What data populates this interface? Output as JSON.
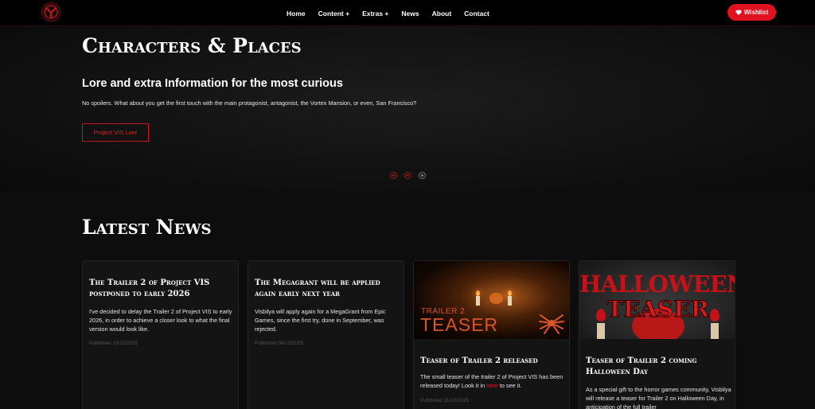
{
  "nav": {
    "logo_icon": "vortex-logo-icon",
    "links": [
      "Home",
      "Content +",
      "Extras +",
      "News",
      "About",
      "Contact"
    ],
    "wishlist_label": "Wishlist",
    "wishlist_icon": "heart-icon",
    "accent_color": "#e0121f"
  },
  "hero": {
    "title": "Characters & Places",
    "subtitle": "Lore and extra Information for the most curious",
    "text": "No spoilers. What about you get the first touch with the main protagonist, antagonist, the Vortex Mansion, or even, San Francisco?",
    "button_label": "Project VIS Lore",
    "slide_count": 3,
    "active_slide": 3
  },
  "news": {
    "title": "Latest News",
    "cards": [
      {
        "title": "The Trailer 2 of Project VIS postponed to early 2026",
        "text": "I've decided to delay the Trailer 2 of Project VIS to early 2026, in order to achieve a closer look to what the final version would look like.",
        "date": "Published 13/12/2025"
      },
      {
        "title": "The Megagrant will be applied again early next year",
        "text": "Visbilya will apply again for a MegaGrant from Epic Games, since the first try, done in September, was rejected.",
        "date": "Published 06/12/2025"
      },
      {
        "title": "Teaser of Trailer 2 released",
        "text_before": "The small teaser of the trailer 2 of Project VIS has been released today! Look it in",
        "link_text": "here",
        "text_after": "to see it.",
        "date": "Published 31/10/2025",
        "image": {
          "small_text": "TRAILER 2",
          "big_text": "TEASER",
          "icon": "spider-icon"
        }
      },
      {
        "title": "Teaser of Trailer 2 coming Halloween Day",
        "text": "As a special gift to the horror games community, Visbilya will release a teaser for Trailer 2 on Halloween Day, in anticipation of the full trailer",
        "image": {
          "line1": "HALLOWEEN",
          "line2": "TEASER"
        }
      }
    ]
  }
}
